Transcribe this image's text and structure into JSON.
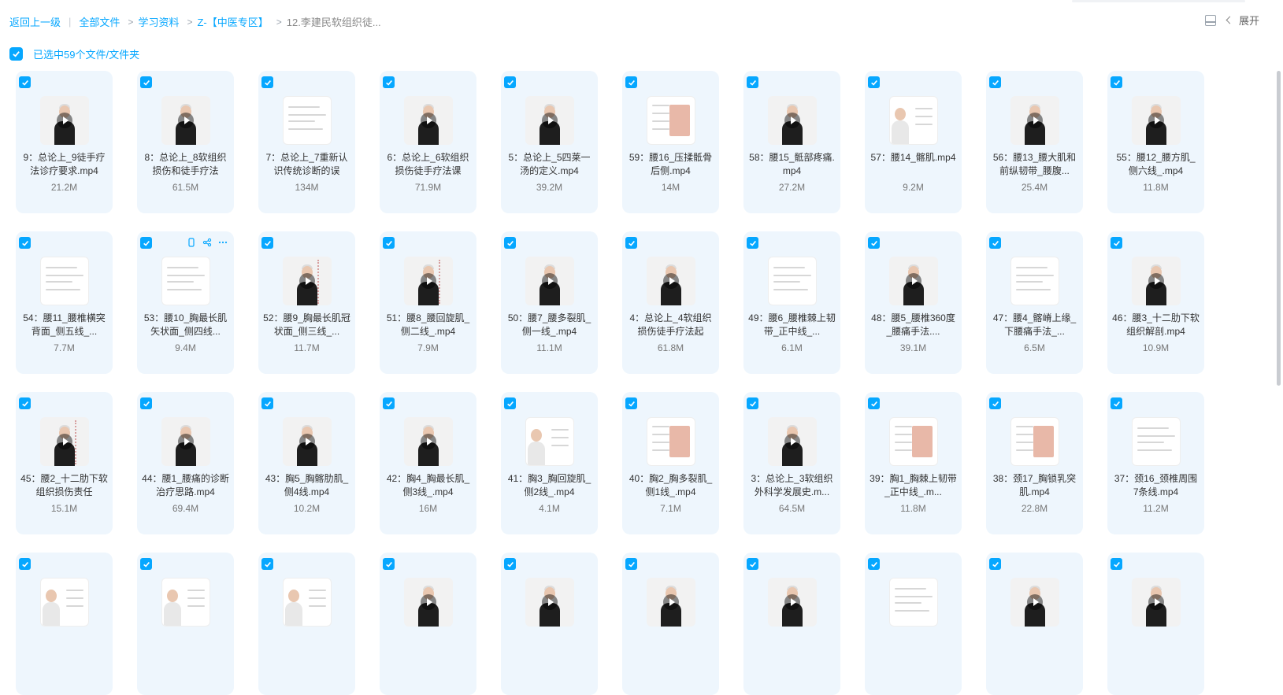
{
  "breadcrumb": {
    "back": "返回上一级",
    "items": [
      "全部文件",
      "学习资料",
      "Z-【中医专区】",
      "12.李建民软组织徒..."
    ]
  },
  "topright": {
    "expand_label": "展开"
  },
  "selection": {
    "label": "已选中59个文件/文件夹"
  },
  "colors": {
    "accent": "#06a7ff",
    "card_bg": "#eef6fd"
  },
  "files": [
    {
      "name": "9：总论上_9徒手疗法诊疗要求.mp4",
      "size": "21.2M",
      "thumb": "video"
    },
    {
      "name": "8：总论上_8软组织损伤和徒手疗法",
      "size": "61.5M",
      "thumb": "video"
    },
    {
      "name": "7：总论上_7重新认识传统诊断的误",
      "size": "134M",
      "thumb": "doc"
    },
    {
      "name": "6：总论上_6软组织损伤徒手疗法课",
      "size": "71.9M",
      "thumb": "video"
    },
    {
      "name": "5：总论上_5四莱一汤的定义.mp4",
      "size": "39.2M",
      "thumb": "video"
    },
    {
      "name": "59：腰16_压揉骶骨后侧.mp4",
      "size": "14M",
      "thumb": "doc-img"
    },
    {
      "name": "58：腰15_骶部疼痛.mp4",
      "size": "27.2M",
      "thumb": "video"
    },
    {
      "name": "57：腰14_髂肌.mp4",
      "size": "9.2M",
      "thumb": "doc-person"
    },
    {
      "name": "56：腰13_腰大肌和前纵韧带_腰腹...",
      "size": "25.4M",
      "thumb": "video"
    },
    {
      "name": "55：腰12_腰方肌_侧六线_.mp4",
      "size": "11.8M",
      "thumb": "video"
    },
    {
      "name": "54：腰11_腰椎横突背面_侧五线_...",
      "size": "7.7M",
      "thumb": "doc"
    },
    {
      "name": "53：腰10_胸最长肌矢状面_侧四线...",
      "size": "9.4M",
      "thumb": "doc"
    },
    {
      "name": "52：腰9_胸最长肌冠状面_侧三线_...",
      "size": "11.7M",
      "thumb": "video-big"
    },
    {
      "name": "51：腰8_腰回旋肌_侧二线_.mp4",
      "size": "7.9M",
      "thumb": "video-big"
    },
    {
      "name": "50：腰7_腰多裂肌_侧一线_.mp4",
      "size": "11.1M",
      "thumb": "video"
    },
    {
      "name": "4：总论上_4软组织损伤徒手疗法起",
      "size": "61.8M",
      "thumb": "video"
    },
    {
      "name": "49：腰6_腰椎棘上韧带_正中线_...",
      "size": "6.1M",
      "thumb": "doc"
    },
    {
      "name": "48：腰5_腰椎360度_腰痛手法....",
      "size": "39.1M",
      "thumb": "video"
    },
    {
      "name": "47：腰4_髂嵴上缘_下腰痛手法_...",
      "size": "6.5M",
      "thumb": "doc"
    },
    {
      "name": "46：腰3_十二肋下软组织解剖.mp4",
      "size": "10.9M",
      "thumb": "video"
    },
    {
      "name": "45：腰2_十二肋下软组织损伤责任",
      "size": "15.1M",
      "thumb": "video-big"
    },
    {
      "name": "44：腰1_腰痛的诊断治疗思路.mp4",
      "size": "69.4M",
      "thumb": "video"
    },
    {
      "name": "43：胸5_胸髂肋肌_侧4线.mp4",
      "size": "10.2M",
      "thumb": "video"
    },
    {
      "name": "42：胸4_胸最长肌_侧3线_.mp4",
      "size": "16M",
      "thumb": "video"
    },
    {
      "name": "41：胸3_胸回旋肌_侧2线_.mp4",
      "size": "4.1M",
      "thumb": "doc-person"
    },
    {
      "name": "40：胸2_胸多裂肌_侧1线_.mp4",
      "size": "7.1M",
      "thumb": "doc-img"
    },
    {
      "name": "3：总论上_3软组织外科学发展史.m...",
      "size": "64.5M",
      "thumb": "video"
    },
    {
      "name": "39：胸1_胸棘上韧带_正中线_.m...",
      "size": "11.8M",
      "thumb": "doc-img"
    },
    {
      "name": "38：颈17_胸锁乳突肌.mp4",
      "size": "22.8M",
      "thumb": "doc-img"
    },
    {
      "name": "37：颈16_颈椎周围7条线.mp4",
      "size": "11.2M",
      "thumb": "doc"
    },
    {
      "name": "",
      "size": "",
      "thumb": "doc-person"
    },
    {
      "name": "",
      "size": "",
      "thumb": "doc-person"
    },
    {
      "name": "",
      "size": "",
      "thumb": "doc-person"
    },
    {
      "name": "",
      "size": "",
      "thumb": "video"
    },
    {
      "name": "",
      "size": "",
      "thumb": "video"
    },
    {
      "name": "",
      "size": "",
      "thumb": "video"
    },
    {
      "name": "",
      "size": "",
      "thumb": "video"
    },
    {
      "name": "",
      "size": "",
      "thumb": "doc"
    },
    {
      "name": "",
      "size": "",
      "thumb": "video"
    },
    {
      "name": "",
      "size": "",
      "thumb": "video"
    }
  ]
}
